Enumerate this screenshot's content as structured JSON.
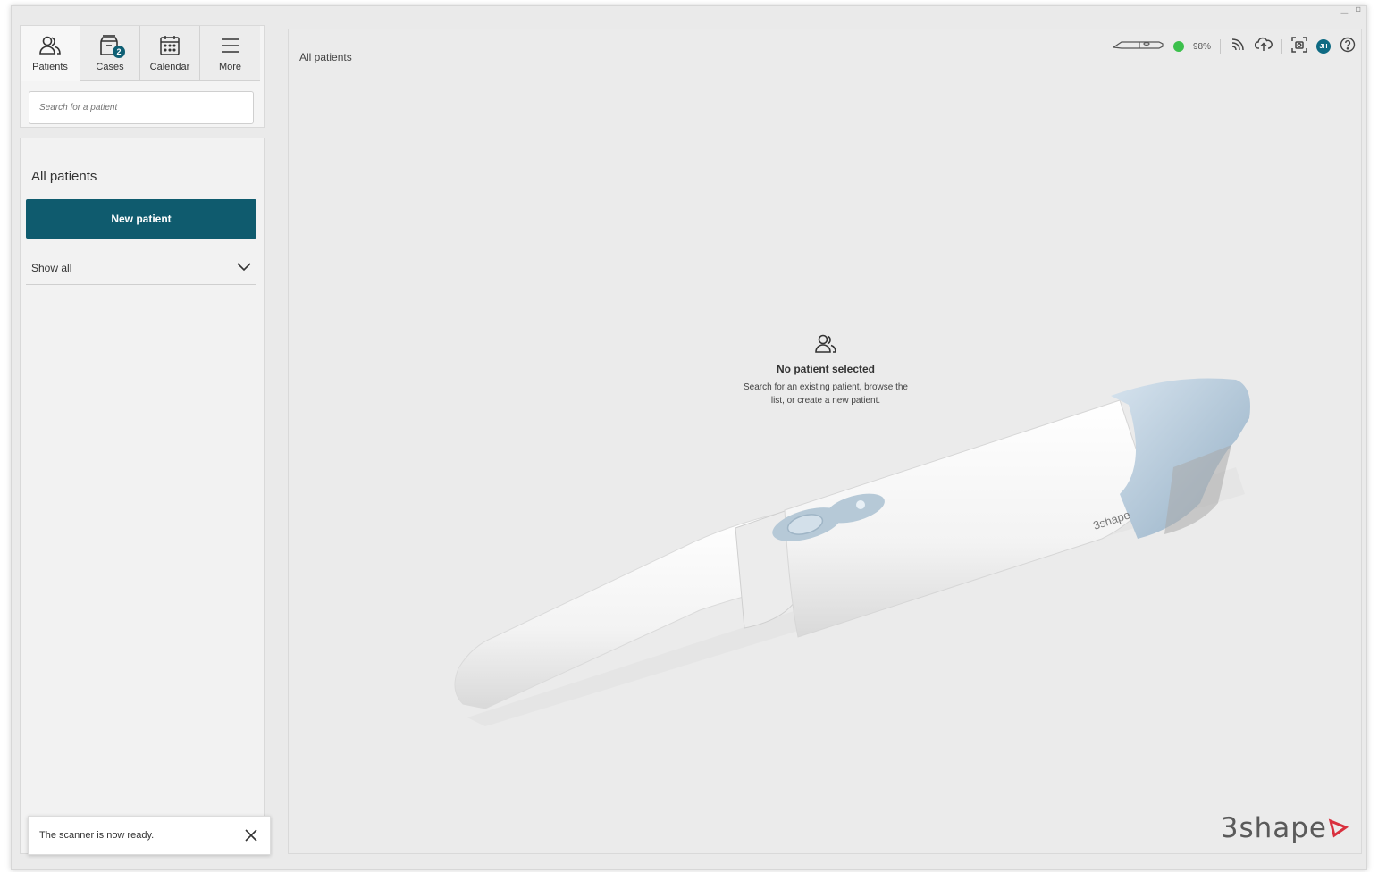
{
  "nav": {
    "tabs": [
      {
        "label": "Patients",
        "icon": "patients-icon",
        "active": true
      },
      {
        "label": "Cases",
        "icon": "cases-icon",
        "badge": "2"
      },
      {
        "label": "Calendar",
        "icon": "calendar-icon"
      },
      {
        "label": "More",
        "icon": "menu-icon"
      }
    ],
    "search_placeholder": "Search for a patient"
  },
  "sidebar": {
    "title": "All patients",
    "new_patient_label": "New patient",
    "filter_label": "Show all"
  },
  "toast": {
    "message": "The scanner is now ready."
  },
  "main": {
    "breadcrumb": "All patients",
    "status": {
      "battery_percent": "98%",
      "connection_color": "#3cc04c",
      "user_initials": "JH"
    },
    "empty_state": {
      "title": "No patient selected",
      "message_line1": "Search for an existing patient, browse the",
      "message_line2": "list, or create a new patient."
    },
    "scanner_brand": "3shape",
    "brand_logo": "3shape"
  },
  "colors": {
    "accent": "#0f5b6e",
    "badge": "#0e5f74",
    "logo_red": "#d9303e"
  }
}
